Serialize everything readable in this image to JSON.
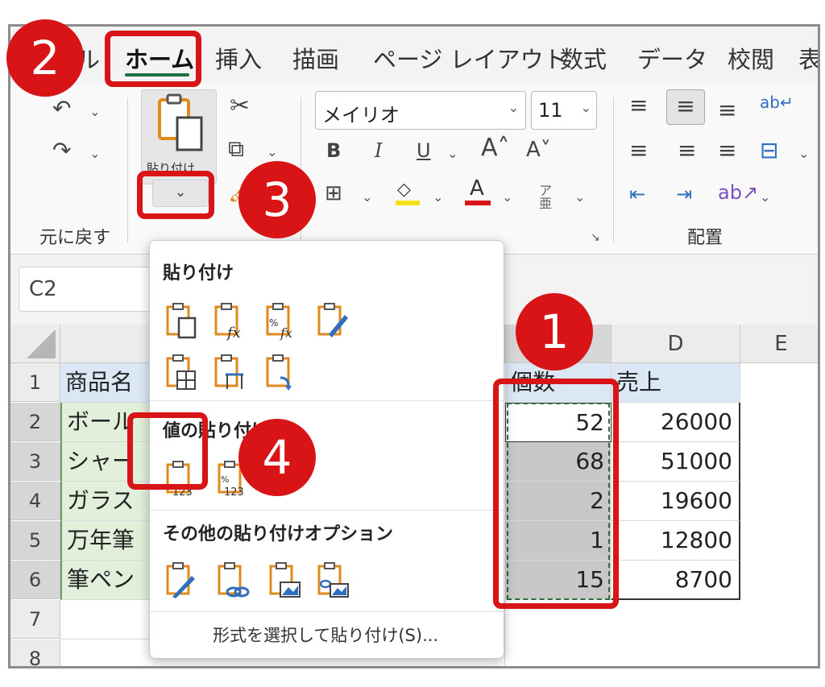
{
  "tabs": [
    "ル",
    "ホーム",
    "挿入",
    "描画",
    "ページ レイアウト",
    "数式",
    "データ",
    "校閲",
    "表"
  ],
  "ribbon": {
    "undo_group_label": "元に戻す",
    "paste_label": "貼り付け",
    "font_name": "メイリオ",
    "font_size": "11",
    "bold": "B",
    "italic": "I",
    "underline": "U",
    "align_group_label": "配置"
  },
  "name_box": "C2",
  "sheet": {
    "columns": [
      "D",
      "E"
    ],
    "rows": [
      "1",
      "2",
      "3",
      "4",
      "5",
      "6",
      "7",
      "8"
    ],
    "col_a": [
      "商品名",
      "ボール",
      "シャー",
      "ガラス",
      "万年筆",
      "筆ペン"
    ],
    "col_c": [
      "個数",
      "52",
      "68",
      "2",
      "1",
      "15"
    ],
    "col_d": [
      "売上",
      "26000",
      "51000",
      "19600",
      "12800",
      "8700"
    ]
  },
  "paste_menu": {
    "section_paste": "貼り付け",
    "section_values": "値の貼り付け",
    "section_other": "その他の貼り付けオプション",
    "special": "形式を選択して貼り付け(S)..."
  },
  "badges": [
    "1",
    "2",
    "3",
    "4"
  ],
  "colors": {
    "accent_red": "#d81417",
    "excel_green": "#1e7145",
    "header_fill": "#dbe7f5",
    "item_fill": "#e2efda",
    "selected_fill": "#c8c8c8"
  }
}
